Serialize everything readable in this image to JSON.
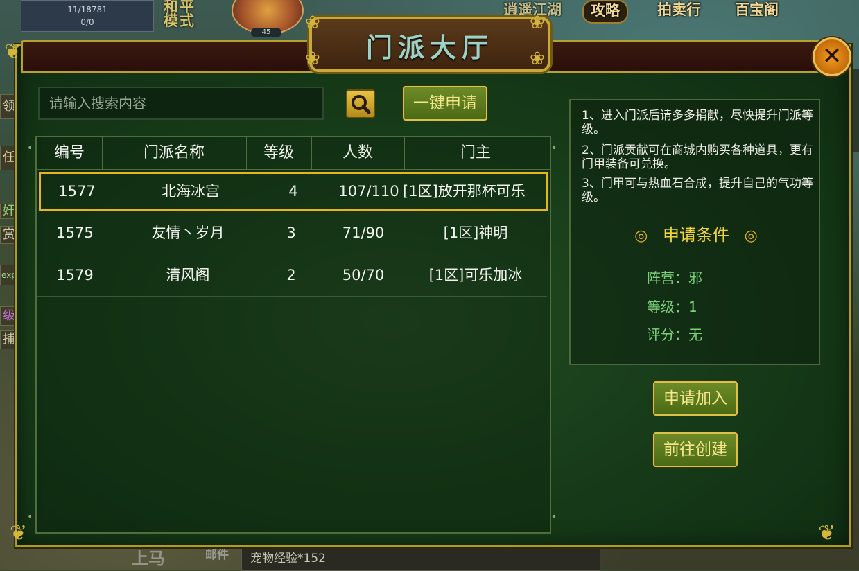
{
  "hud": {
    "stat_line1": "11/18781",
    "stat_line2": "0/0",
    "peace_line1": "和平",
    "peace_line2": "模式",
    "avatar_level": "45",
    "top_buttons": [
      "逍遥江湖",
      "攻略",
      "拍卖行",
      "百宝阁"
    ],
    "left_side": [
      "领",
      "任务",
      "奸",
      "赏",
      "exp",
      "级",
      "捕"
    ],
    "bottom_mount": "上马",
    "bottom_mail": "邮件",
    "bottom_text": "宠物经验*152"
  },
  "dialog": {
    "title": "门派大厅",
    "close_symbol": "✕"
  },
  "search": {
    "placeholder": "请输入搜索内容",
    "one_click_apply": "一键申请"
  },
  "table": {
    "headers": [
      "编号",
      "门派名称",
      "等级",
      "人数",
      "门主"
    ],
    "rows": [
      {
        "id": "1577",
        "name": "北海冰宫",
        "level": "4",
        "members": "107/110",
        "leader": "[1区]放开那杯可乐"
      },
      {
        "id": "1575",
        "name": "友情丶岁月",
        "level": "3",
        "members": "71/90",
        "leader": "[1区]神明"
      },
      {
        "id": "1579",
        "name": "清风阁",
        "level": "2",
        "members": "50/70",
        "leader": "[1区]可乐加冰"
      }
    ]
  },
  "info": {
    "tips": [
      "1、进入门派后请多多捐献，尽快提升门派等级。",
      "2、门派贡献可在商城内购买各种道具，更有门甲装备可兑换。",
      "3、门甲可与热血石合成，提升自己的气功等级。"
    ],
    "conditions_title": "申请条件",
    "conditions": [
      "阵营：邪",
      "等级：1",
      "评分：无"
    ]
  },
  "actions": {
    "apply_join": "申请加入",
    "go_create": "前往创建"
  },
  "colors": {
    "accent_gold": "#e8b424",
    "condition_green": "#7cd07a",
    "title_yellow": "#f2d33a"
  }
}
